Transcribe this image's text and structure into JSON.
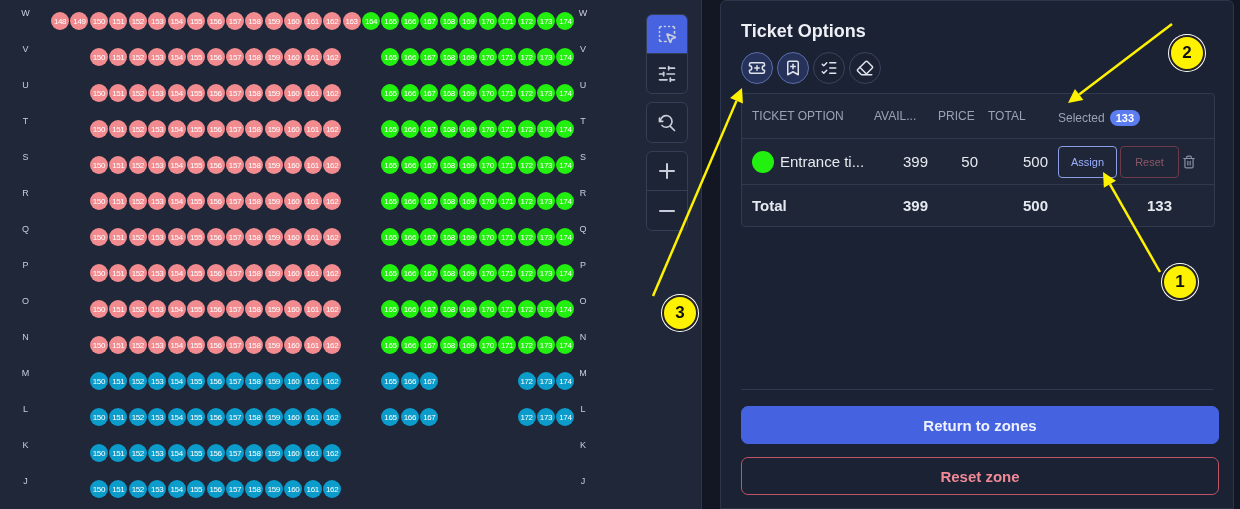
{
  "seat_map": {
    "rows": [
      {
        "label": "W",
        "label_right": "W",
        "seats": [
          {
            "kind": "seat",
            "number": "148",
            "color": "#f28b8f"
          },
          {
            "kind": "seat",
            "number": "149",
            "color": "#f28b8f"
          },
          {
            "kind": "seat",
            "number": "150",
            "color": "#f28b8f"
          },
          {
            "kind": "seat",
            "number": "151",
            "color": "#f28b8f"
          },
          {
            "kind": "seat",
            "number": "152",
            "color": "#f28b8f"
          },
          {
            "kind": "seat",
            "number": "153",
            "color": "#f28b8f"
          },
          {
            "kind": "seat",
            "number": "154",
            "color": "#f28b8f"
          },
          {
            "kind": "seat",
            "number": "155",
            "color": "#f28b8f"
          },
          {
            "kind": "seat",
            "number": "156",
            "color": "#f28b8f"
          },
          {
            "kind": "seat",
            "number": "157",
            "color": "#f28b8f"
          },
          {
            "kind": "seat",
            "number": "158",
            "color": "#f28b8f"
          },
          {
            "kind": "seat",
            "number": "159",
            "color": "#f28b8f"
          },
          {
            "kind": "seat",
            "number": "160",
            "color": "#f28b8f"
          },
          {
            "kind": "seat",
            "number": "161",
            "color": "#f28b8f"
          },
          {
            "kind": "seat",
            "number": "162",
            "color": "#f28b8f"
          },
          {
            "kind": "seat",
            "number": "163",
            "color": "#f28b8f"
          },
          {
            "kind": "seat",
            "number": "164",
            "color": "#22f00f"
          },
          {
            "kind": "seat",
            "number": "165",
            "color": "#22f00f"
          },
          {
            "kind": "seat",
            "number": "166",
            "color": "#22f00f"
          },
          {
            "kind": "seat",
            "number": "167",
            "color": "#22f00f"
          },
          {
            "kind": "seat",
            "number": "168",
            "color": "#22f00f"
          },
          {
            "kind": "seat",
            "number": "169",
            "color": "#22f00f"
          },
          {
            "kind": "seat",
            "number": "170",
            "color": "#22f00f"
          },
          {
            "kind": "seat",
            "number": "171",
            "color": "#22f00f"
          },
          {
            "kind": "seat",
            "number": "172",
            "color": "#22f00f"
          },
          {
            "kind": "seat",
            "number": "173",
            "color": "#22f00f"
          },
          {
            "kind": "seat",
            "number": "174",
            "color": "#22f00f"
          }
        ]
      },
      {
        "label": "V",
        "label_right": "V",
        "seats": [
          {
            "kind": "gap"
          },
          {
            "kind": "gap"
          },
          {
            "kind": "seat",
            "number": "150",
            "color": "#f28b8f"
          },
          {
            "kind": "seat",
            "number": "151",
            "color": "#f28b8f"
          },
          {
            "kind": "seat",
            "number": "152",
            "color": "#f28b8f"
          },
          {
            "kind": "seat",
            "number": "153",
            "color": "#f28b8f"
          },
          {
            "kind": "seat",
            "number": "154",
            "color": "#f28b8f"
          },
          {
            "kind": "seat",
            "number": "155",
            "color": "#f28b8f"
          },
          {
            "kind": "seat",
            "number": "156",
            "color": "#f28b8f"
          },
          {
            "kind": "seat",
            "number": "157",
            "color": "#f28b8f"
          },
          {
            "kind": "seat",
            "number": "158",
            "color": "#f28b8f"
          },
          {
            "kind": "seat",
            "number": "159",
            "color": "#f28b8f"
          },
          {
            "kind": "seat",
            "number": "160",
            "color": "#f28b8f"
          },
          {
            "kind": "seat",
            "number": "161",
            "color": "#f28b8f"
          },
          {
            "kind": "seat",
            "number": "162",
            "color": "#f28b8f"
          },
          {
            "kind": "gap"
          },
          {
            "kind": "gap"
          },
          {
            "kind": "seat",
            "number": "165",
            "color": "#22f00f"
          },
          {
            "kind": "seat",
            "number": "166",
            "color": "#22f00f"
          },
          {
            "kind": "seat",
            "number": "167",
            "color": "#22f00f"
          },
          {
            "kind": "seat",
            "number": "168",
            "color": "#22f00f"
          },
          {
            "kind": "seat",
            "number": "169",
            "color": "#22f00f"
          },
          {
            "kind": "seat",
            "number": "170",
            "color": "#22f00f"
          },
          {
            "kind": "seat",
            "number": "171",
            "color": "#22f00f"
          },
          {
            "kind": "seat",
            "number": "172",
            "color": "#22f00f"
          },
          {
            "kind": "seat",
            "number": "173",
            "color": "#22f00f"
          },
          {
            "kind": "seat",
            "number": "174",
            "color": "#22f00f"
          }
        ]
      },
      {
        "label": "U",
        "label_right": "U",
        "seats": [
          {
            "kind": "gap"
          },
          {
            "kind": "gap"
          },
          {
            "kind": "seat",
            "number": "150",
            "color": "#f28b8f"
          },
          {
            "kind": "seat",
            "number": "151",
            "color": "#f28b8f"
          },
          {
            "kind": "seat",
            "number": "152",
            "color": "#f28b8f"
          },
          {
            "kind": "seat",
            "number": "153",
            "color": "#f28b8f"
          },
          {
            "kind": "seat",
            "number": "154",
            "color": "#f28b8f"
          },
          {
            "kind": "seat",
            "number": "155",
            "color": "#f28b8f"
          },
          {
            "kind": "seat",
            "number": "156",
            "color": "#f28b8f"
          },
          {
            "kind": "seat",
            "number": "157",
            "color": "#f28b8f"
          },
          {
            "kind": "seat",
            "number": "158",
            "color": "#f28b8f"
          },
          {
            "kind": "seat",
            "number": "159",
            "color": "#f28b8f"
          },
          {
            "kind": "seat",
            "number": "160",
            "color": "#f28b8f"
          },
          {
            "kind": "seat",
            "number": "161",
            "color": "#f28b8f"
          },
          {
            "kind": "seat",
            "number": "162",
            "color": "#f28b8f"
          },
          {
            "kind": "gap"
          },
          {
            "kind": "gap"
          },
          {
            "kind": "seat",
            "number": "165",
            "color": "#22f00f"
          },
          {
            "kind": "seat",
            "number": "166",
            "color": "#22f00f"
          },
          {
            "kind": "seat",
            "number": "167",
            "color": "#22f00f"
          },
          {
            "kind": "seat",
            "number": "168",
            "color": "#22f00f"
          },
          {
            "kind": "seat",
            "number": "169",
            "color": "#22f00f"
          },
          {
            "kind": "seat",
            "number": "170",
            "color": "#22f00f"
          },
          {
            "kind": "seat",
            "number": "171",
            "color": "#22f00f"
          },
          {
            "kind": "seat",
            "number": "172",
            "color": "#22f00f"
          },
          {
            "kind": "seat",
            "number": "173",
            "color": "#22f00f"
          },
          {
            "kind": "seat",
            "number": "174",
            "color": "#22f00f"
          }
        ]
      },
      {
        "label": "T",
        "label_right": "T",
        "seats": [
          {
            "kind": "gap"
          },
          {
            "kind": "gap"
          },
          {
            "kind": "seat",
            "number": "150",
            "color": "#f28b8f"
          },
          {
            "kind": "seat",
            "number": "151",
            "color": "#f28b8f"
          },
          {
            "kind": "seat",
            "number": "152",
            "color": "#f28b8f"
          },
          {
            "kind": "seat",
            "number": "153",
            "color": "#f28b8f"
          },
          {
            "kind": "seat",
            "number": "154",
            "color": "#f28b8f"
          },
          {
            "kind": "seat",
            "number": "155",
            "color": "#f28b8f"
          },
          {
            "kind": "seat",
            "number": "156",
            "color": "#f28b8f"
          },
          {
            "kind": "seat",
            "number": "157",
            "color": "#f28b8f"
          },
          {
            "kind": "seat",
            "number": "158",
            "color": "#f28b8f"
          },
          {
            "kind": "seat",
            "number": "159",
            "color": "#f28b8f"
          },
          {
            "kind": "seat",
            "number": "160",
            "color": "#f28b8f"
          },
          {
            "kind": "seat",
            "number": "161",
            "color": "#f28b8f"
          },
          {
            "kind": "seat",
            "number": "162",
            "color": "#f28b8f"
          },
          {
            "kind": "gap"
          },
          {
            "kind": "gap"
          },
          {
            "kind": "seat",
            "number": "165",
            "color": "#22f00f"
          },
          {
            "kind": "seat",
            "number": "166",
            "color": "#22f00f"
          },
          {
            "kind": "seat",
            "number": "167",
            "color": "#22f00f"
          },
          {
            "kind": "seat",
            "number": "168",
            "color": "#22f00f"
          },
          {
            "kind": "seat",
            "number": "169",
            "color": "#22f00f"
          },
          {
            "kind": "seat",
            "number": "170",
            "color": "#22f00f"
          },
          {
            "kind": "seat",
            "number": "171",
            "color": "#22f00f"
          },
          {
            "kind": "seat",
            "number": "172",
            "color": "#22f00f"
          },
          {
            "kind": "seat",
            "number": "173",
            "color": "#22f00f"
          },
          {
            "kind": "seat",
            "number": "174",
            "color": "#22f00f"
          }
        ]
      },
      {
        "label": "S",
        "label_right": "S",
        "seats": [
          {
            "kind": "gap"
          },
          {
            "kind": "gap"
          },
          {
            "kind": "seat",
            "number": "150",
            "color": "#f28b8f"
          },
          {
            "kind": "seat",
            "number": "151",
            "color": "#f28b8f"
          },
          {
            "kind": "seat",
            "number": "152",
            "color": "#f28b8f"
          },
          {
            "kind": "seat",
            "number": "153",
            "color": "#f28b8f"
          },
          {
            "kind": "seat",
            "number": "154",
            "color": "#f28b8f"
          },
          {
            "kind": "seat",
            "number": "155",
            "color": "#f28b8f"
          },
          {
            "kind": "seat",
            "number": "156",
            "color": "#f28b8f"
          },
          {
            "kind": "seat",
            "number": "157",
            "color": "#f28b8f"
          },
          {
            "kind": "seat",
            "number": "158",
            "color": "#f28b8f"
          },
          {
            "kind": "seat",
            "number": "159",
            "color": "#f28b8f"
          },
          {
            "kind": "seat",
            "number": "160",
            "color": "#f28b8f"
          },
          {
            "kind": "seat",
            "number": "161",
            "color": "#f28b8f"
          },
          {
            "kind": "seat",
            "number": "162",
            "color": "#f28b8f"
          },
          {
            "kind": "gap"
          },
          {
            "kind": "gap"
          },
          {
            "kind": "seat",
            "number": "165",
            "color": "#22f00f"
          },
          {
            "kind": "seat",
            "number": "166",
            "color": "#22f00f"
          },
          {
            "kind": "seat",
            "number": "167",
            "color": "#22f00f"
          },
          {
            "kind": "seat",
            "number": "168",
            "color": "#22f00f"
          },
          {
            "kind": "seat",
            "number": "169",
            "color": "#22f00f"
          },
          {
            "kind": "seat",
            "number": "170",
            "color": "#22f00f"
          },
          {
            "kind": "seat",
            "number": "171",
            "color": "#22f00f"
          },
          {
            "kind": "seat",
            "number": "172",
            "color": "#22f00f"
          },
          {
            "kind": "seat",
            "number": "173",
            "color": "#22f00f"
          },
          {
            "kind": "seat",
            "number": "174",
            "color": "#22f00f"
          }
        ]
      },
      {
        "label": "R",
        "label_right": "R",
        "seats": [
          {
            "kind": "gap"
          },
          {
            "kind": "gap"
          },
          {
            "kind": "seat",
            "number": "150",
            "color": "#f28b8f"
          },
          {
            "kind": "seat",
            "number": "151",
            "color": "#f28b8f"
          },
          {
            "kind": "seat",
            "number": "152",
            "color": "#f28b8f"
          },
          {
            "kind": "seat",
            "number": "153",
            "color": "#f28b8f"
          },
          {
            "kind": "seat",
            "number": "154",
            "color": "#f28b8f"
          },
          {
            "kind": "seat",
            "number": "155",
            "color": "#f28b8f"
          },
          {
            "kind": "seat",
            "number": "156",
            "color": "#f28b8f"
          },
          {
            "kind": "seat",
            "number": "157",
            "color": "#f28b8f"
          },
          {
            "kind": "seat",
            "number": "158",
            "color": "#f28b8f"
          },
          {
            "kind": "seat",
            "number": "159",
            "color": "#f28b8f"
          },
          {
            "kind": "seat",
            "number": "160",
            "color": "#f28b8f"
          },
          {
            "kind": "seat",
            "number": "161",
            "color": "#f28b8f"
          },
          {
            "kind": "seat",
            "number": "162",
            "color": "#f28b8f"
          },
          {
            "kind": "gap"
          },
          {
            "kind": "gap"
          },
          {
            "kind": "seat",
            "number": "165",
            "color": "#22f00f"
          },
          {
            "kind": "seat",
            "number": "166",
            "color": "#22f00f"
          },
          {
            "kind": "seat",
            "number": "167",
            "color": "#22f00f"
          },
          {
            "kind": "seat",
            "number": "168",
            "color": "#22f00f"
          },
          {
            "kind": "seat",
            "number": "169",
            "color": "#22f00f"
          },
          {
            "kind": "seat",
            "number": "170",
            "color": "#22f00f"
          },
          {
            "kind": "seat",
            "number": "171",
            "color": "#22f00f"
          },
          {
            "kind": "seat",
            "number": "172",
            "color": "#22f00f"
          },
          {
            "kind": "seat",
            "number": "173",
            "color": "#22f00f"
          },
          {
            "kind": "seat",
            "number": "174",
            "color": "#22f00f"
          }
        ]
      },
      {
        "label": "Q",
        "label_right": "Q",
        "seats": [
          {
            "kind": "gap"
          },
          {
            "kind": "gap"
          },
          {
            "kind": "seat",
            "number": "150",
            "color": "#f28b8f"
          },
          {
            "kind": "seat",
            "number": "151",
            "color": "#f28b8f"
          },
          {
            "kind": "seat",
            "number": "152",
            "color": "#f28b8f"
          },
          {
            "kind": "seat",
            "number": "153",
            "color": "#f28b8f"
          },
          {
            "kind": "seat",
            "number": "154",
            "color": "#f28b8f"
          },
          {
            "kind": "seat",
            "number": "155",
            "color": "#f28b8f"
          },
          {
            "kind": "seat",
            "number": "156",
            "color": "#f28b8f"
          },
          {
            "kind": "seat",
            "number": "157",
            "color": "#f28b8f"
          },
          {
            "kind": "seat",
            "number": "158",
            "color": "#f28b8f"
          },
          {
            "kind": "seat",
            "number": "159",
            "color": "#f28b8f"
          },
          {
            "kind": "seat",
            "number": "160",
            "color": "#f28b8f"
          },
          {
            "kind": "seat",
            "number": "161",
            "color": "#f28b8f"
          },
          {
            "kind": "seat",
            "number": "162",
            "color": "#f28b8f"
          },
          {
            "kind": "gap"
          },
          {
            "kind": "gap"
          },
          {
            "kind": "seat",
            "number": "165",
            "color": "#22f00f"
          },
          {
            "kind": "seat",
            "number": "166",
            "color": "#22f00f"
          },
          {
            "kind": "seat",
            "number": "167",
            "color": "#22f00f"
          },
          {
            "kind": "seat",
            "number": "168",
            "color": "#22f00f"
          },
          {
            "kind": "seat",
            "number": "169",
            "color": "#22f00f"
          },
          {
            "kind": "seat",
            "number": "170",
            "color": "#22f00f"
          },
          {
            "kind": "seat",
            "number": "171",
            "color": "#22f00f"
          },
          {
            "kind": "seat",
            "number": "172",
            "color": "#22f00f"
          },
          {
            "kind": "seat",
            "number": "173",
            "color": "#22f00f"
          },
          {
            "kind": "seat",
            "number": "174",
            "color": "#22f00f"
          }
        ]
      },
      {
        "label": "P",
        "label_right": "P",
        "seats": [
          {
            "kind": "gap"
          },
          {
            "kind": "gap"
          },
          {
            "kind": "seat",
            "number": "150",
            "color": "#f28b8f"
          },
          {
            "kind": "seat",
            "number": "151",
            "color": "#f28b8f"
          },
          {
            "kind": "seat",
            "number": "152",
            "color": "#f28b8f"
          },
          {
            "kind": "seat",
            "number": "153",
            "color": "#f28b8f"
          },
          {
            "kind": "seat",
            "number": "154",
            "color": "#f28b8f"
          },
          {
            "kind": "seat",
            "number": "155",
            "color": "#f28b8f"
          },
          {
            "kind": "seat",
            "number": "156",
            "color": "#f28b8f"
          },
          {
            "kind": "seat",
            "number": "157",
            "color": "#f28b8f"
          },
          {
            "kind": "seat",
            "number": "158",
            "color": "#f28b8f"
          },
          {
            "kind": "seat",
            "number": "159",
            "color": "#f28b8f"
          },
          {
            "kind": "seat",
            "number": "160",
            "color": "#f28b8f"
          },
          {
            "kind": "seat",
            "number": "161",
            "color": "#f28b8f"
          },
          {
            "kind": "seat",
            "number": "162",
            "color": "#f28b8f"
          },
          {
            "kind": "gap"
          },
          {
            "kind": "gap"
          },
          {
            "kind": "seat",
            "number": "165",
            "color": "#22f00f"
          },
          {
            "kind": "seat",
            "number": "166",
            "color": "#22f00f"
          },
          {
            "kind": "seat",
            "number": "167",
            "color": "#22f00f"
          },
          {
            "kind": "seat",
            "number": "168",
            "color": "#22f00f"
          },
          {
            "kind": "seat",
            "number": "169",
            "color": "#22f00f"
          },
          {
            "kind": "seat",
            "number": "170",
            "color": "#22f00f"
          },
          {
            "kind": "seat",
            "number": "171",
            "color": "#22f00f"
          },
          {
            "kind": "seat",
            "number": "172",
            "color": "#22f00f"
          },
          {
            "kind": "seat",
            "number": "173",
            "color": "#22f00f"
          },
          {
            "kind": "seat",
            "number": "174",
            "color": "#22f00f"
          }
        ]
      },
      {
        "label": "O",
        "label_right": "O",
        "seats": [
          {
            "kind": "gap"
          },
          {
            "kind": "gap"
          },
          {
            "kind": "seat",
            "number": "150",
            "color": "#f28b8f"
          },
          {
            "kind": "seat",
            "number": "151",
            "color": "#f28b8f"
          },
          {
            "kind": "seat",
            "number": "152",
            "color": "#f28b8f"
          },
          {
            "kind": "seat",
            "number": "153",
            "color": "#f28b8f"
          },
          {
            "kind": "seat",
            "number": "154",
            "color": "#f28b8f"
          },
          {
            "kind": "seat",
            "number": "155",
            "color": "#f28b8f"
          },
          {
            "kind": "seat",
            "number": "156",
            "color": "#f28b8f"
          },
          {
            "kind": "seat",
            "number": "157",
            "color": "#f28b8f"
          },
          {
            "kind": "seat",
            "number": "158",
            "color": "#f28b8f"
          },
          {
            "kind": "seat",
            "number": "159",
            "color": "#f28b8f"
          },
          {
            "kind": "seat",
            "number": "160",
            "color": "#f28b8f"
          },
          {
            "kind": "seat",
            "number": "161",
            "color": "#f28b8f"
          },
          {
            "kind": "seat",
            "number": "162",
            "color": "#f28b8f"
          },
          {
            "kind": "gap"
          },
          {
            "kind": "gap"
          },
          {
            "kind": "seat",
            "number": "165",
            "color": "#22f00f"
          },
          {
            "kind": "seat",
            "number": "166",
            "color": "#22f00f"
          },
          {
            "kind": "seat",
            "number": "167",
            "color": "#22f00f"
          },
          {
            "kind": "seat",
            "number": "168",
            "color": "#22f00f"
          },
          {
            "kind": "seat",
            "number": "169",
            "color": "#22f00f"
          },
          {
            "kind": "seat",
            "number": "170",
            "color": "#22f00f"
          },
          {
            "kind": "seat",
            "number": "171",
            "color": "#22f00f"
          },
          {
            "kind": "seat",
            "number": "172",
            "color": "#22f00f"
          },
          {
            "kind": "seat",
            "number": "173",
            "color": "#22f00f"
          },
          {
            "kind": "seat",
            "number": "174",
            "color": "#22f00f"
          }
        ]
      },
      {
        "label": "N",
        "label_right": "N",
        "seats": [
          {
            "kind": "gap"
          },
          {
            "kind": "gap"
          },
          {
            "kind": "seat",
            "number": "150",
            "color": "#f28b8f"
          },
          {
            "kind": "seat",
            "number": "151",
            "color": "#f28b8f"
          },
          {
            "kind": "seat",
            "number": "152",
            "color": "#f28b8f"
          },
          {
            "kind": "seat",
            "number": "153",
            "color": "#f28b8f"
          },
          {
            "kind": "seat",
            "number": "154",
            "color": "#f28b8f"
          },
          {
            "kind": "seat",
            "number": "155",
            "color": "#f28b8f"
          },
          {
            "kind": "seat",
            "number": "156",
            "color": "#f28b8f"
          },
          {
            "kind": "seat",
            "number": "157",
            "color": "#f28b8f"
          },
          {
            "kind": "seat",
            "number": "158",
            "color": "#f28b8f"
          },
          {
            "kind": "seat",
            "number": "159",
            "color": "#f28b8f"
          },
          {
            "kind": "seat",
            "number": "160",
            "color": "#f28b8f"
          },
          {
            "kind": "seat",
            "number": "161",
            "color": "#f28b8f"
          },
          {
            "kind": "seat",
            "number": "162",
            "color": "#f28b8f"
          },
          {
            "kind": "gap"
          },
          {
            "kind": "gap"
          },
          {
            "kind": "seat",
            "number": "165",
            "color": "#22f00f"
          },
          {
            "kind": "seat",
            "number": "166",
            "color": "#22f00f"
          },
          {
            "kind": "seat",
            "number": "167",
            "color": "#22f00f"
          },
          {
            "kind": "seat",
            "number": "168",
            "color": "#22f00f"
          },
          {
            "kind": "seat",
            "number": "169",
            "color": "#22f00f"
          },
          {
            "kind": "seat",
            "number": "170",
            "color": "#22f00f"
          },
          {
            "kind": "seat",
            "number": "171",
            "color": "#22f00f"
          },
          {
            "kind": "seat",
            "number": "172",
            "color": "#22f00f"
          },
          {
            "kind": "seat",
            "number": "173",
            "color": "#22f00f"
          },
          {
            "kind": "seat",
            "number": "174",
            "color": "#22f00f"
          }
        ]
      },
      {
        "label": "M",
        "label_right": "M",
        "seats": [
          {
            "kind": "gap"
          },
          {
            "kind": "gap"
          },
          {
            "kind": "seat",
            "number": "150",
            "color": "#0b9ccb"
          },
          {
            "kind": "seat",
            "number": "151",
            "color": "#0b9ccb"
          },
          {
            "kind": "seat",
            "number": "152",
            "color": "#0b9ccb"
          },
          {
            "kind": "seat",
            "number": "153",
            "color": "#0b9ccb"
          },
          {
            "kind": "seat",
            "number": "154",
            "color": "#0b9ccb"
          },
          {
            "kind": "seat",
            "number": "155",
            "color": "#0b9ccb"
          },
          {
            "kind": "seat",
            "number": "156",
            "color": "#0b9ccb"
          },
          {
            "kind": "seat",
            "number": "157",
            "color": "#0b9ccb"
          },
          {
            "kind": "seat",
            "number": "158",
            "color": "#0b9ccb"
          },
          {
            "kind": "seat",
            "number": "159",
            "color": "#0b9ccb"
          },
          {
            "kind": "seat",
            "number": "160",
            "color": "#0b9ccb"
          },
          {
            "kind": "seat",
            "number": "161",
            "color": "#0b9ccb"
          },
          {
            "kind": "seat",
            "number": "162",
            "color": "#0b9ccb"
          },
          {
            "kind": "gap"
          },
          {
            "kind": "gap"
          },
          {
            "kind": "seat",
            "number": "165",
            "color": "#0b9ccb"
          },
          {
            "kind": "seat",
            "number": "166",
            "color": "#0b9ccb"
          },
          {
            "kind": "seat",
            "number": "167",
            "color": "#0b9ccb"
          },
          {
            "kind": "gap"
          },
          {
            "kind": "gap"
          },
          {
            "kind": "gap"
          },
          {
            "kind": "gap"
          },
          {
            "kind": "seat",
            "number": "172",
            "color": "#0b9ccb"
          },
          {
            "kind": "seat",
            "number": "173",
            "color": "#0b9ccb"
          },
          {
            "kind": "seat",
            "number": "174",
            "color": "#0b9ccb"
          }
        ]
      },
      {
        "label": "L",
        "label_right": "L",
        "seats": [
          {
            "kind": "gap"
          },
          {
            "kind": "gap"
          },
          {
            "kind": "seat",
            "number": "150",
            "color": "#0b9ccb"
          },
          {
            "kind": "seat",
            "number": "151",
            "color": "#0b9ccb"
          },
          {
            "kind": "seat",
            "number": "152",
            "color": "#0b9ccb"
          },
          {
            "kind": "seat",
            "number": "153",
            "color": "#0b9ccb"
          },
          {
            "kind": "seat",
            "number": "154",
            "color": "#0b9ccb"
          },
          {
            "kind": "seat",
            "number": "155",
            "color": "#0b9ccb"
          },
          {
            "kind": "seat",
            "number": "156",
            "color": "#0b9ccb"
          },
          {
            "kind": "seat",
            "number": "157",
            "color": "#0b9ccb"
          },
          {
            "kind": "seat",
            "number": "158",
            "color": "#0b9ccb"
          },
          {
            "kind": "seat",
            "number": "159",
            "color": "#0b9ccb"
          },
          {
            "kind": "seat",
            "number": "160",
            "color": "#0b9ccb"
          },
          {
            "kind": "seat",
            "number": "161",
            "color": "#0b9ccb"
          },
          {
            "kind": "seat",
            "number": "162",
            "color": "#0b9ccb"
          },
          {
            "kind": "gap"
          },
          {
            "kind": "gap"
          },
          {
            "kind": "seat",
            "number": "165",
            "color": "#0b9ccb"
          },
          {
            "kind": "seat",
            "number": "166",
            "color": "#0b9ccb"
          },
          {
            "kind": "seat",
            "number": "167",
            "color": "#0b9ccb"
          },
          {
            "kind": "gap"
          },
          {
            "kind": "gap"
          },
          {
            "kind": "gap"
          },
          {
            "kind": "gap"
          },
          {
            "kind": "seat",
            "number": "172",
            "color": "#0b9ccb"
          },
          {
            "kind": "seat",
            "number": "173",
            "color": "#0b9ccb"
          },
          {
            "kind": "seat",
            "number": "174",
            "color": "#0b9ccb"
          }
        ]
      },
      {
        "label": "K",
        "label_right": "K",
        "seats": [
          {
            "kind": "gap"
          },
          {
            "kind": "gap"
          },
          {
            "kind": "seat",
            "number": "150",
            "color": "#0b9ccb"
          },
          {
            "kind": "seat",
            "number": "151",
            "color": "#0b9ccb"
          },
          {
            "kind": "seat",
            "number": "152",
            "color": "#0b9ccb"
          },
          {
            "kind": "seat",
            "number": "153",
            "color": "#0b9ccb"
          },
          {
            "kind": "seat",
            "number": "154",
            "color": "#0b9ccb"
          },
          {
            "kind": "seat",
            "number": "155",
            "color": "#0b9ccb"
          },
          {
            "kind": "seat",
            "number": "156",
            "color": "#0b9ccb"
          },
          {
            "kind": "seat",
            "number": "157",
            "color": "#0b9ccb"
          },
          {
            "kind": "seat",
            "number": "158",
            "color": "#0b9ccb"
          },
          {
            "kind": "seat",
            "number": "159",
            "color": "#0b9ccb"
          },
          {
            "kind": "seat",
            "number": "160",
            "color": "#0b9ccb"
          },
          {
            "kind": "seat",
            "number": "161",
            "color": "#0b9ccb"
          },
          {
            "kind": "seat",
            "number": "162",
            "color": "#0b9ccb"
          }
        ]
      },
      {
        "label": "J",
        "label_right": "J",
        "seats": [
          {
            "kind": "gap"
          },
          {
            "kind": "gap"
          },
          {
            "kind": "seat",
            "number": "150",
            "color": "#0b9ccb"
          },
          {
            "kind": "seat",
            "number": "151",
            "color": "#0b9ccb"
          },
          {
            "kind": "seat",
            "number": "152",
            "color": "#0b9ccb"
          },
          {
            "kind": "seat",
            "number": "153",
            "color": "#0b9ccb"
          },
          {
            "kind": "seat",
            "number": "154",
            "color": "#0b9ccb"
          },
          {
            "kind": "seat",
            "number": "155",
            "color": "#0b9ccb"
          },
          {
            "kind": "seat",
            "number": "156",
            "color": "#0b9ccb"
          },
          {
            "kind": "seat",
            "number": "157",
            "color": "#0b9ccb"
          },
          {
            "kind": "seat",
            "number": "158",
            "color": "#0b9ccb"
          },
          {
            "kind": "seat",
            "number": "159",
            "color": "#0b9ccb"
          },
          {
            "kind": "seat",
            "number": "160",
            "color": "#0b9ccb"
          },
          {
            "kind": "seat",
            "number": "161",
            "color": "#0b9ccb"
          },
          {
            "kind": "seat",
            "number": "162",
            "color": "#0b9ccb"
          }
        ]
      }
    ]
  },
  "map_toolbar": {
    "tools": [
      {
        "kind": "select",
        "selected": true
      },
      {
        "kind": "sliders",
        "selected": false
      },
      {
        "kind": "zoom-reset",
        "selected": false
      },
      {
        "kind": "zoom-in",
        "selected": false
      },
      {
        "kind": "zoom-out",
        "selected": false
      }
    ]
  },
  "ticket_options": {
    "title": "Ticket Options",
    "actions": [
      {
        "kind": "ticket-plus",
        "selected": true
      },
      {
        "kind": "bookmark-plus",
        "selected": true
      },
      {
        "kind": "list-checks",
        "selected": false
      },
      {
        "kind": "eraser",
        "selected": false
      }
    ],
    "table": {
      "columns": [
        "TICKET OPTION",
        "AVAIL...",
        "PRICE",
        "TOTAL"
      ],
      "selected_label": "Selected",
      "selected_count": "133",
      "rows": [
        {
          "color": "#22f00f",
          "name": "Entrance ti...",
          "available": "399",
          "price": "50",
          "total": "500",
          "assign": "Assign",
          "reset": "Reset"
        }
      ],
      "total_row": {
        "label": "Total",
        "available": "399",
        "total": "500",
        "selected": "133"
      }
    },
    "buttons": [
      {
        "kind": "primary",
        "label": "Return to zones"
      },
      {
        "kind": "danger",
        "label": "Reset zone"
      }
    ]
  },
  "callouts": [
    {
      "label": "1"
    },
    {
      "label": "2"
    },
    {
      "label": "3"
    }
  ]
}
